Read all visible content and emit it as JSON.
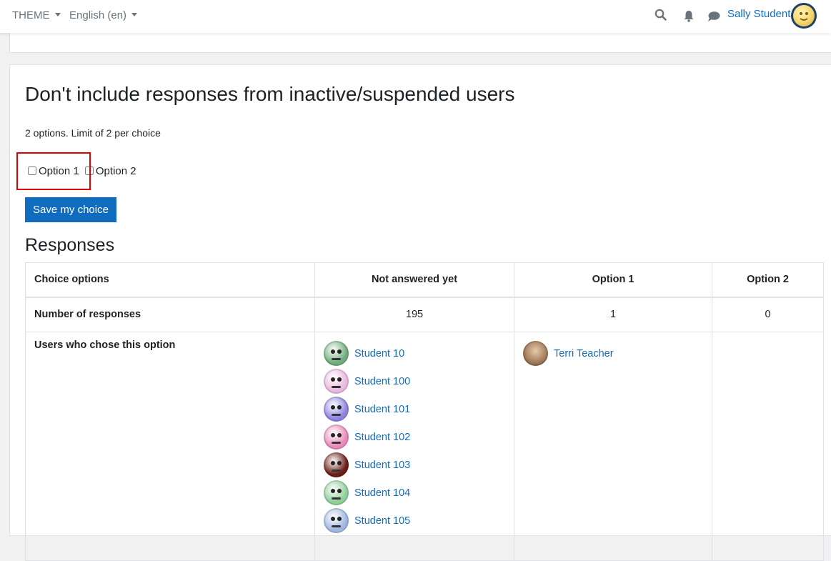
{
  "navbar": {
    "theme_label": "THEME",
    "language_label": "English (en)",
    "user_name": "Sally Student"
  },
  "activity": {
    "title": "Don't include responses from inactive/suspended users",
    "options_info": "2 options. Limit of 2 per choice",
    "options": [
      {
        "label": "Option 1",
        "checked": false
      },
      {
        "label": "Option 2",
        "checked": false
      }
    ],
    "save_label": "Save my choice"
  },
  "responses": {
    "heading": "Responses",
    "headers": [
      "Choice options",
      "Not answered yet",
      "Option 1",
      "Option 2"
    ],
    "count_row": {
      "label": "Number of responses",
      "values": [
        "195",
        "1",
        "0"
      ]
    },
    "users_row": {
      "label": "Users who chose this option",
      "not_answered": [
        {
          "name": "Student 10",
          "color": "#6fae7a"
        },
        {
          "name": "Student 100",
          "color": "#e9b8de"
        },
        {
          "name": "Student 101",
          "color": "#8e84e0"
        },
        {
          "name": "Student 102",
          "color": "#e98ab8"
        },
        {
          "name": "Student 103",
          "color": "#6b1d14"
        },
        {
          "name": "Student 104",
          "color": "#8fcf98"
        },
        {
          "name": "Student 105",
          "color": "#9fb7e0"
        }
      ],
      "option1": [
        {
          "name": "Terri Teacher",
          "color": "#a07a5a"
        }
      ],
      "option2": []
    }
  },
  "colors": {
    "link": "#0f6cbf",
    "primary_button": "#0f6cbf",
    "highlight": "#e00000"
  }
}
